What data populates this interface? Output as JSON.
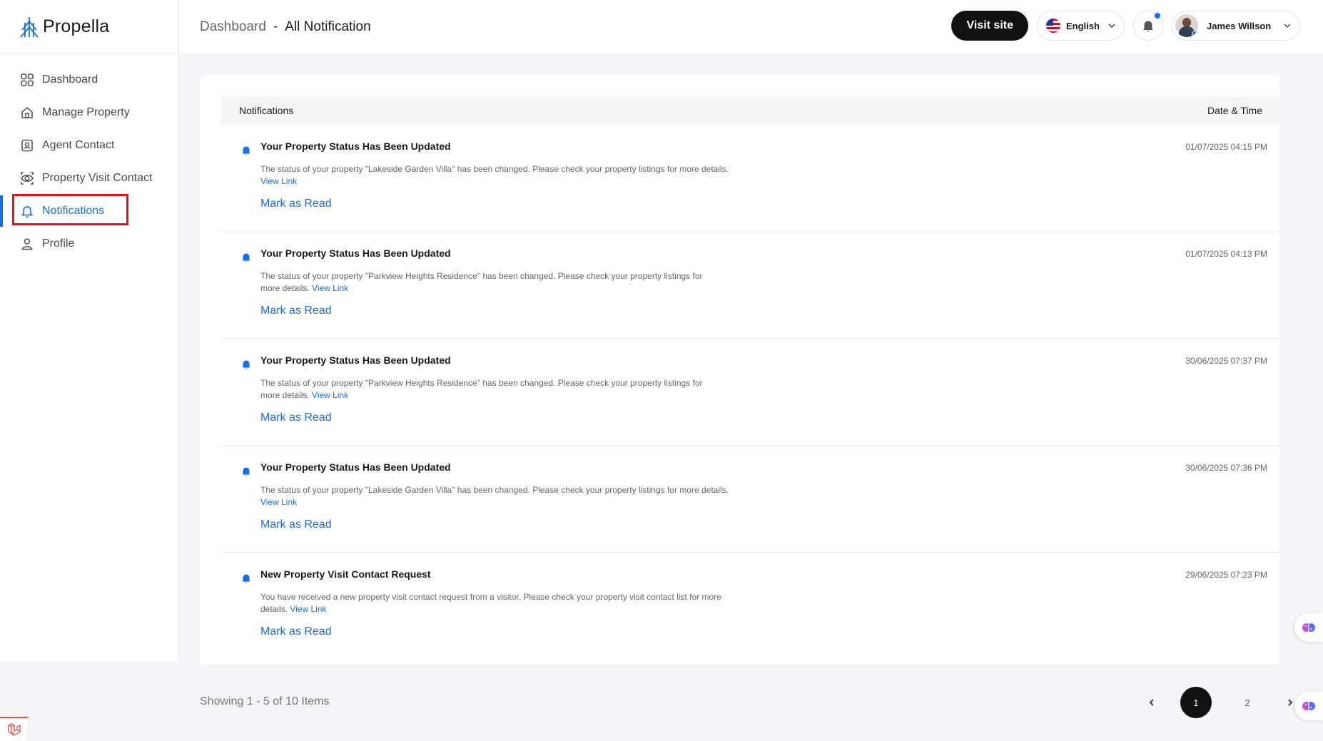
{
  "app": {
    "name": "Propella"
  },
  "sidebar": {
    "items": [
      {
        "label": "Dashboard",
        "icon": "grid-icon"
      },
      {
        "label": "Manage Property",
        "icon": "house-icon"
      },
      {
        "label": "Agent Contact",
        "icon": "contact-icon"
      },
      {
        "label": "Property Visit Contact",
        "icon": "eye-icon"
      },
      {
        "label": "Notifications",
        "icon": "bell-icon",
        "active": true
      },
      {
        "label": "Profile",
        "icon": "user-icon"
      }
    ]
  },
  "header": {
    "breadcrumb_root": "Dashboard",
    "breadcrumb_sep": "-",
    "breadcrumb_current": "All Notification",
    "visit_label": "Visit site",
    "language": "English",
    "user_name": "James Willson"
  },
  "table": {
    "col_notifications": "Notifications",
    "col_datetime": "Date & Time",
    "link_label": "View Link",
    "mark_label": "Mark as Read",
    "rows": [
      {
        "title": "Your Property Status Has Been Updated",
        "desc": "The status of your property \"Lakeside Garden Villa\" has been changed. Please check your property listings for more details.",
        "time": "01/07/2025 04:15 PM"
      },
      {
        "title": "Your Property Status Has Been Updated",
        "desc": "The status of your property \"Parkview Heights Residence\" has been changed. Please check your property listings for more details.",
        "time": "01/07/2025 04:13 PM"
      },
      {
        "title": "Your Property Status Has Been Updated",
        "desc": "The status of your property \"Parkview Heights Residence\" has been changed. Please check your property listings for more details.",
        "time": "30/06/2025 07:37 PM"
      },
      {
        "title": "Your Property Status Has Been Updated",
        "desc": "The status of your property \"Lakeside Garden Villa\" has been changed. Please check your property listings for more details.",
        "time": "30/06/2025 07:36 PM"
      },
      {
        "title": "New Property Visit Contact Request",
        "desc": "You have received a new property visit contact request from a visitor. Please check your property visit contact list for more details.",
        "time": "29/06/2025 07:23 PM"
      }
    ]
  },
  "pagination": {
    "summary": "Showing 1 - 5 of 10 Items",
    "pages": [
      "1",
      "2"
    ],
    "current": "1"
  },
  "colors": {
    "accent": "#1a6fe0",
    "highlight_box": "#e0141b",
    "dark": "#111111"
  }
}
